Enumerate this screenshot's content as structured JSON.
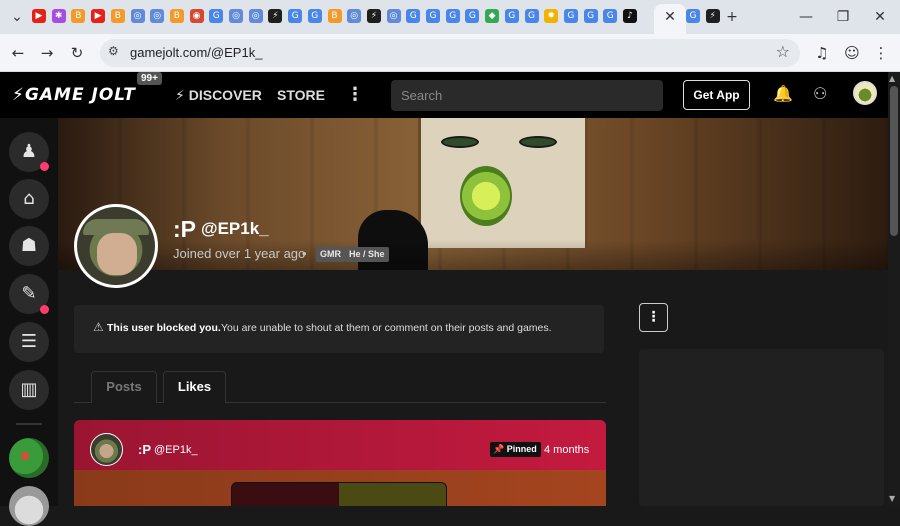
{
  "browser": {
    "url": "gamejolt.com/@EP1k_",
    "tab_favicons": [
      {
        "name": "youtube-favicon",
        "glyph": "▶",
        "color": "#e62117"
      },
      {
        "name": "pinwheel-favicon",
        "glyph": "✱",
        "color": "#a64ce0"
      },
      {
        "name": "b-favicon",
        "glyph": "B",
        "color": "#f39a2b"
      },
      {
        "name": "youtube-favicon",
        "glyph": "▶",
        "color": "#e62117"
      },
      {
        "name": "b-favicon",
        "glyph": "B",
        "color": "#f39a2b"
      },
      {
        "name": "chrome-favicon",
        "glyph": "◎",
        "color": "#5f8bd9"
      },
      {
        "name": "chrome-favicon",
        "glyph": "◎",
        "color": "#5f8bd9"
      },
      {
        "name": "b-favicon",
        "glyph": "B",
        "color": "#f39a2b"
      },
      {
        "name": "red-circle-favicon",
        "glyph": "◉",
        "color": "#d24a2f"
      },
      {
        "name": "google-favicon",
        "glyph": "G",
        "color": "#4a86e8"
      },
      {
        "name": "chrome-favicon",
        "glyph": "◎",
        "color": "#5f8bd9"
      },
      {
        "name": "chrome-favicon",
        "glyph": "◎",
        "color": "#5f8bd9"
      },
      {
        "name": "gamejolt-favicon",
        "glyph": "⚡",
        "color": "#1f1f1f"
      },
      {
        "name": "google-favicon",
        "glyph": "G",
        "color": "#4a86e8"
      },
      {
        "name": "google-favicon",
        "glyph": "G",
        "color": "#4a86e8"
      },
      {
        "name": "b-favicon",
        "glyph": "B",
        "color": "#f39a2b"
      },
      {
        "name": "chrome-favicon",
        "glyph": "◎",
        "color": "#5f8bd9"
      },
      {
        "name": "gamejolt-favicon",
        "glyph": "⚡",
        "color": "#1f1f1f"
      },
      {
        "name": "chrome-favicon",
        "glyph": "◎",
        "color": "#5f8bd9"
      },
      {
        "name": "google-favicon",
        "glyph": "G",
        "color": "#4a86e8"
      },
      {
        "name": "google-favicon",
        "glyph": "G",
        "color": "#4a86e8"
      },
      {
        "name": "google-favicon",
        "glyph": "G",
        "color": "#4a86e8"
      },
      {
        "name": "google-favicon",
        "glyph": "G",
        "color": "#4a86e8"
      },
      {
        "name": "maps-favicon",
        "glyph": "◆",
        "color": "#34a853"
      },
      {
        "name": "google-favicon",
        "glyph": "G",
        "color": "#4a86e8"
      },
      {
        "name": "google-favicon",
        "glyph": "G",
        "color": "#4a86e8"
      },
      {
        "name": "sun-favicon",
        "glyph": "✹",
        "color": "#f0b400"
      },
      {
        "name": "google-favicon",
        "glyph": "G",
        "color": "#4a86e8"
      },
      {
        "name": "google-favicon",
        "glyph": "G",
        "color": "#4a86e8"
      },
      {
        "name": "google-favicon",
        "glyph": "G",
        "color": "#4a86e8"
      },
      {
        "name": "tiktok-favicon",
        "glyph": "♪",
        "color": "#111111"
      }
    ],
    "after_tab_favicons": [
      {
        "name": "google-favicon",
        "glyph": "G",
        "color": "#4a86e8"
      },
      {
        "name": "gamejolt-favicon",
        "glyph": "⚡",
        "color": "#1f1f1f"
      }
    ]
  },
  "header": {
    "logo": "GAME JOLT",
    "notification_count": "99+",
    "nav": [
      "DISCOVER",
      "STORE"
    ],
    "search_placeholder": "Search",
    "get_app": "Get App"
  },
  "profile": {
    "display_name": ":P",
    "username": "@EP1k_",
    "joined": "Joined over 1 year ago",
    "tags": [
      "GMR",
      "He / She"
    ]
  },
  "notice": {
    "bold": "This user blocked you.",
    "rest": "You are unable to shout at them or comment on their posts and games."
  },
  "tabs": [
    "Posts",
    "Likes"
  ],
  "post": {
    "name": ":P",
    "username": "@EP1k_",
    "pinned": "Pinned",
    "age": "4 months"
  },
  "colors": {
    "accent_pink": "#ff3d6c",
    "post_red": "#b01840"
  }
}
